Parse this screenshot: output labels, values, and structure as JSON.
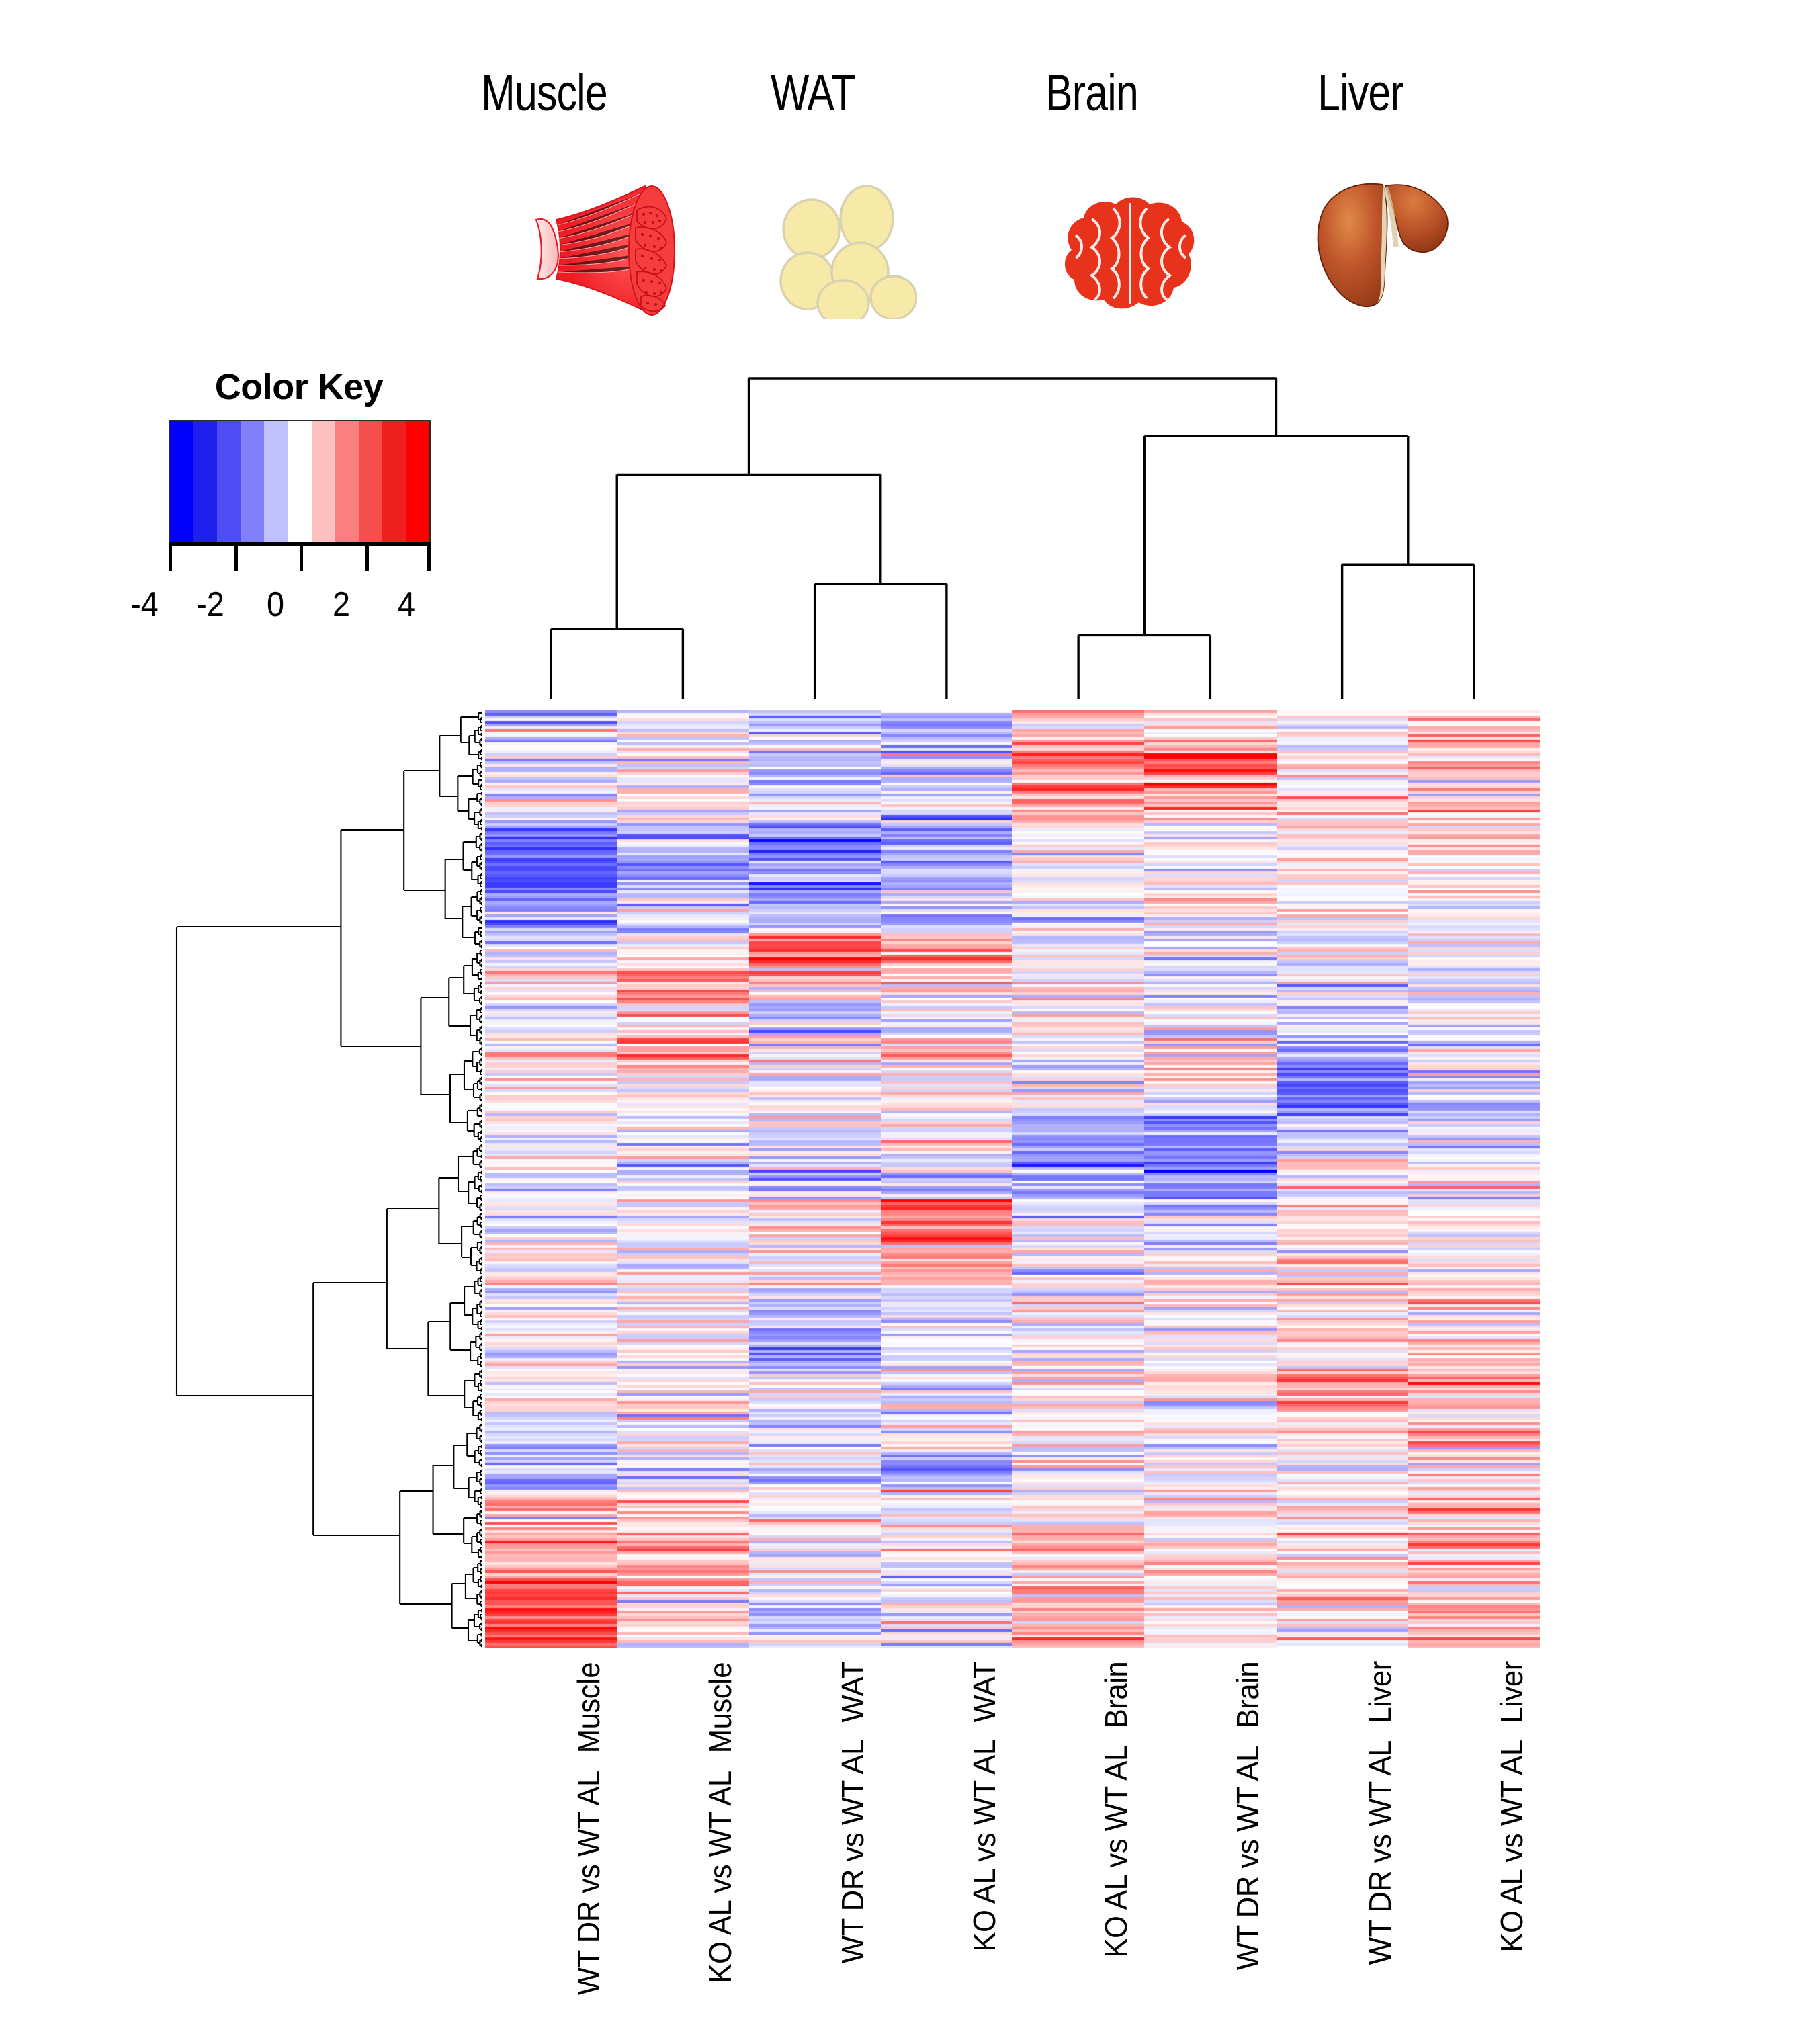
{
  "figure": {
    "type": "heatmap-with-dendrograms",
    "background": "#ffffff"
  },
  "tissues": [
    {
      "name": "Muscle",
      "icon": "muscle-icon",
      "icon_color": "#ee1c25"
    },
    {
      "name": "WAT",
      "icon": "adipocytes-icon",
      "icon_color": "#f7e9a8"
    },
    {
      "name": "Brain",
      "icon": "brain-icon",
      "icon_color": "#e8331c"
    },
    {
      "name": "Liver",
      "icon": "liver-icon",
      "icon_color": "#a8431c"
    }
  ],
  "color_key": {
    "title": "Color Key",
    "tick_labels": [
      "-4",
      "-2",
      "0",
      "2",
      "4"
    ],
    "tick_values": [
      -4,
      -2,
      0,
      2,
      4
    ],
    "range": [
      -4,
      4
    ],
    "low_color": "#0000ff",
    "mid_color": "#ffffff",
    "high_color": "#ff0000",
    "bands": [
      "#0000ff",
      "#1f1fee",
      "#4d4df5",
      "#8080fb",
      "#c0c0fd",
      "#ffffff",
      "#fdc0c0",
      "#fa8080",
      "#f64d4d",
      "#f01f1f",
      "#ff0000"
    ]
  },
  "chart_data": {
    "type": "heatmap",
    "title": "",
    "xlabel": "",
    "ylabel": "",
    "value_range": [
      -4,
      4
    ],
    "n_rows": 349,
    "n_cols": 8,
    "columns": [
      {
        "tissue": "Muscle",
        "comparison": "WT DR vs WT AL",
        "label_line1": "Muscle",
        "label_line2": "WT DR vs WT AL"
      },
      {
        "tissue": "Muscle",
        "comparison": "KO AL vs WT AL",
        "label_line1": "Muscle",
        "label_line2": "KO AL vs WT AL"
      },
      {
        "tissue": "WAT",
        "comparison": "WT DR vs WT AL",
        "label_line1": "WAT",
        "label_line2": "WT DR vs WT AL"
      },
      {
        "tissue": "WAT",
        "comparison": "KO AL vs WT AL",
        "label_line1": "WAT",
        "label_line2": "KO AL vs WT AL"
      },
      {
        "tissue": "Brain",
        "comparison": "KO AL vs WT AL",
        "label_line1": "Brain",
        "label_line2": "KO AL vs WT AL"
      },
      {
        "tissue": "Brain",
        "comparison": "WT DR vs WT AL",
        "label_line1": "Brain",
        "label_line2": "WT DR vs WT AL"
      },
      {
        "tissue": "Liver",
        "comparison": "WT DR vs WT AL",
        "label_line1": "Liver",
        "label_line2": "WT DR vs WT AL"
      },
      {
        "tissue": "Liver",
        "comparison": "KO AL vs WT AL",
        "label_line1": "Liver",
        "label_line2": "KO AL vs WT AL"
      }
    ],
    "row_clusters": [
      {
        "from": 0.0,
        "to": 0.04,
        "means": [
          -0.4,
          -0.2,
          -1.0,
          -1.2,
          1.0,
          0.9,
          0.2,
          0.4
        ],
        "sd": 0.9
      },
      {
        "from": 0.04,
        "to": 0.085,
        "means": [
          -0.3,
          0.1,
          -0.9,
          -1.0,
          2.3,
          2.2,
          0.7,
          0.6
        ],
        "sd": 0.9
      },
      {
        "from": 0.085,
        "to": 0.118,
        "means": [
          -0.2,
          0.0,
          -0.6,
          -0.7,
          1.2,
          1.0,
          0.5,
          0.5
        ],
        "sd": 0.9
      },
      {
        "from": 0.118,
        "to": 0.15,
        "means": [
          -2.2,
          -0.9,
          -2.3,
          -1.6,
          0.1,
          0.0,
          0.1,
          0.7
        ],
        "sd": 0.8
      },
      {
        "from": 0.15,
        "to": 0.2,
        "means": [
          -2.6,
          -1.2,
          -1.9,
          -1.3,
          0.0,
          -0.1,
          0.2,
          0.4
        ],
        "sd": 0.8
      },
      {
        "from": 0.2,
        "to": 0.235,
        "means": [
          -1.4,
          -0.7,
          -1.1,
          -1.0,
          0.1,
          0.1,
          0.1,
          0.3
        ],
        "sd": 0.9
      },
      {
        "from": 0.235,
        "to": 0.275,
        "means": [
          -0.2,
          0.2,
          2.6,
          1.2,
          0.0,
          0.0,
          0.1,
          0.2
        ],
        "sd": 0.9
      },
      {
        "from": 0.275,
        "to": 0.31,
        "means": [
          0.1,
          1.6,
          0.9,
          0.4,
          0.1,
          0.0,
          -0.2,
          -0.9
        ],
        "sd": 0.9
      },
      {
        "from": 0.31,
        "to": 0.345,
        "means": [
          -0.3,
          0.2,
          -0.6,
          -0.5,
          0.2,
          0.1,
          -0.5,
          -0.5
        ],
        "sd": 0.9
      },
      {
        "from": 0.345,
        "to": 0.385,
        "means": [
          0.2,
          1.5,
          0.3,
          0.2,
          0.0,
          -0.1,
          -1.6,
          -0.6
        ],
        "sd": 0.9
      },
      {
        "from": 0.385,
        "to": 0.43,
        "means": [
          0.1,
          0.1,
          0.0,
          0.1,
          -0.1,
          0.0,
          -2.2,
          -0.8
        ],
        "sd": 0.8
      },
      {
        "from": 0.43,
        "to": 0.47,
        "means": [
          -0.1,
          0.0,
          -0.2,
          0.3,
          -1.8,
          -2.0,
          -0.5,
          -0.2
        ],
        "sd": 0.8
      },
      {
        "from": 0.47,
        "to": 0.52,
        "means": [
          -0.2,
          -0.1,
          -0.6,
          -0.4,
          -1.5,
          -1.9,
          0.1,
          0.2
        ],
        "sd": 0.9
      },
      {
        "from": 0.52,
        "to": 0.57,
        "means": [
          0.0,
          0.0,
          0.3,
          2.4,
          -0.4,
          -0.4,
          0.4,
          0.3
        ],
        "sd": 0.9
      },
      {
        "from": 0.57,
        "to": 0.61,
        "means": [
          0.1,
          0.0,
          0.2,
          1.6,
          -0.2,
          -0.2,
          0.3,
          0.3
        ],
        "sd": 0.9
      },
      {
        "from": 0.61,
        "to": 0.66,
        "means": [
          -0.1,
          0.0,
          -0.8,
          -0.4,
          0.1,
          0.0,
          0.5,
          0.6
        ],
        "sd": 0.9
      },
      {
        "from": 0.66,
        "to": 0.7,
        "means": [
          0.1,
          0.0,
          -1.9,
          -0.7,
          0.0,
          0.0,
          0.3,
          0.5
        ],
        "sd": 0.8
      },
      {
        "from": 0.7,
        "to": 0.745,
        "means": [
          0.0,
          0.1,
          -0.5,
          -0.2,
          0.1,
          0.0,
          1.9,
          1.0
        ],
        "sd": 0.9
      },
      {
        "from": 0.745,
        "to": 0.79,
        "means": [
          -0.4,
          -0.2,
          -0.4,
          -0.3,
          0.0,
          -0.2,
          0.6,
          1.2
        ],
        "sd": 0.9
      },
      {
        "from": 0.79,
        "to": 0.83,
        "means": [
          -0.9,
          -0.4,
          -0.3,
          -1.3,
          0.1,
          0.0,
          0.3,
          0.6
        ],
        "sd": 0.9
      },
      {
        "from": 0.83,
        "to": 0.88,
        "means": [
          1.1,
          1.0,
          0.1,
          0.1,
          0.6,
          0.3,
          0.7,
          0.9
        ],
        "sd": 0.9
      },
      {
        "from": 0.88,
        "to": 0.935,
        "means": [
          1.4,
          1.5,
          -0.2,
          -0.1,
          0.9,
          0.5,
          0.4,
          1.0
        ],
        "sd": 0.9
      },
      {
        "from": 0.935,
        "to": 1.0,
        "means": [
          2.7,
          0.5,
          -0.6,
          -0.2,
          1.1,
          0.2,
          0.3,
          1.3
        ],
        "sd": 0.9
      }
    ],
    "col_dendrogram": {
      "leaves": [
        0,
        1,
        2,
        3,
        4,
        5,
        6,
        7
      ],
      "merges": [
        {
          "a": "leaf:0",
          "b": "leaf:1",
          "height": 0.22,
          "id": "m0"
        },
        {
          "a": "leaf:2",
          "b": "leaf:3",
          "height": 0.36,
          "id": "m1"
        },
        {
          "a": "m0",
          "b": "m1",
          "height": 0.7,
          "id": "m2"
        },
        {
          "a": "leaf:4",
          "b": "leaf:5",
          "height": 0.2,
          "id": "m3"
        },
        {
          "a": "leaf:6",
          "b": "leaf:7",
          "height": 0.42,
          "id": "m4"
        },
        {
          "a": "m3",
          "b": "m4",
          "height": 0.82,
          "id": "m5"
        },
        {
          "a": "m2",
          "b": "m5",
          "height": 1.0,
          "id": "m6"
        }
      ]
    },
    "row_dendrogram": {
      "description": "dense agglomerative tree of 349 gene rows, leaves at right edge",
      "n_leaves": 349,
      "root_height": 1.0
    }
  },
  "column_labels": [
    {
      "line1": "Muscle",
      "line2": "WT DR vs WT AL"
    },
    {
      "line1": "Muscle",
      "line2": "KO AL vs WT AL"
    },
    {
      "line1": "WAT",
      "line2": "WT DR vs WT AL"
    },
    {
      "line1": "WAT",
      "line2": "KO AL vs WT AL"
    },
    {
      "line1": "Brain",
      "line2": "KO AL vs WT AL"
    },
    {
      "line1": "Brain",
      "line2": "WT DR vs WT AL"
    },
    {
      "line1": "Liver",
      "line2": "WT DR vs WT AL"
    },
    {
      "line1": "Liver",
      "line2": "KO AL vs WT AL"
    }
  ]
}
